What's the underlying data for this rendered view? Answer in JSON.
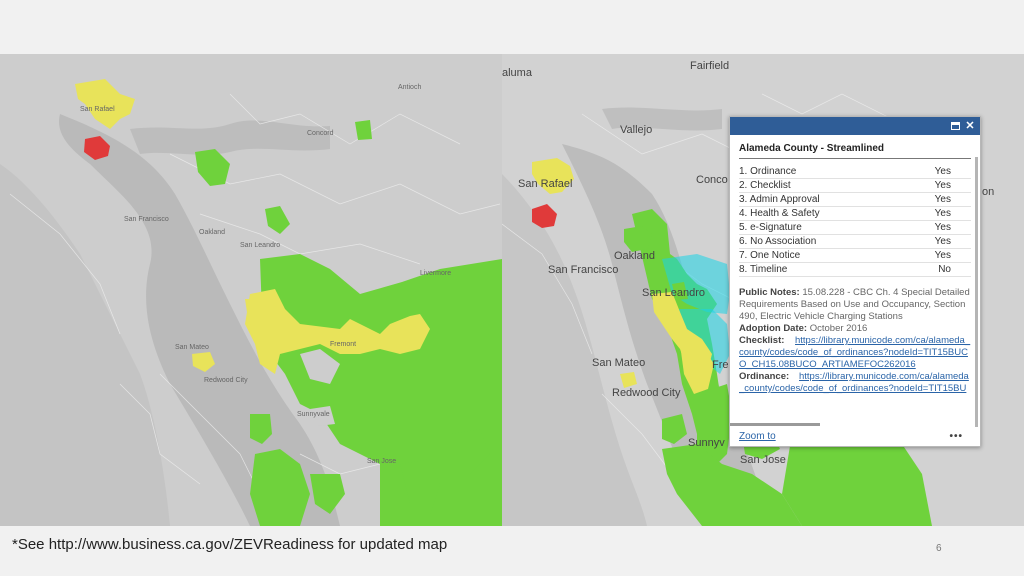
{
  "map_left": {
    "places": [
      "San Rafael",
      "Concord",
      "Antioch",
      "Oakland",
      "San Francisco",
      "San Leandro",
      "Livermore",
      "Fremont",
      "San Mateo",
      "Redwood City",
      "Sunnyvale",
      "San Jose"
    ]
  },
  "map_right": {
    "places": [
      "aluma",
      "Fairfield",
      "Vallejo",
      "Conco",
      "San Rafael",
      "Oakland",
      "San Francisco",
      "San Leandro",
      "San Mateo",
      "Redwood City",
      "Fre",
      "Sunnyv",
      "San Jose",
      "on"
    ]
  },
  "colors": {
    "streamlined": "#6fd23c",
    "partial": "#e8e35a",
    "not_streamlined": "#e03a3a",
    "highlight": "#19d3e6",
    "popup_header": "#2f5d97"
  },
  "popup": {
    "maximize_icon": "maximize-icon",
    "close_icon": "close-icon",
    "close_label": "✕",
    "title": "Alameda County - Streamlined",
    "rows": [
      {
        "label": "1. Ordinance",
        "value": "Yes"
      },
      {
        "label": "2. Checklist",
        "value": "Yes"
      },
      {
        "label": "3. Admin Approval",
        "value": "Yes"
      },
      {
        "label": "4. Health & Safety",
        "value": "Yes"
      },
      {
        "label": "5. e-Signature",
        "value": "Yes"
      },
      {
        "label": "6. No Association",
        "value": "Yes"
      },
      {
        "label": "7. One Notice",
        "value": "Yes"
      },
      {
        "label": "8. Timeline",
        "value": "No"
      }
    ],
    "public_notes_label": "Public Notes:",
    "public_notes": "15.08.228 - CBC Ch. 4 Special Detailed Requirements Based on Use and Occupancy, Section 490, Electric Vehicle Charging Stations",
    "adoption_label": "Adoption Date:",
    "adoption_date": "October 2016",
    "checklist_label": "Checklist:",
    "checklist_link": "https://library.municode.com/ca/alameda_county/codes/code_of_ordinances?nodeId=TIT15BUCO_CH15.08BUCO_ARTIAMEFOC262016",
    "ordinance_label": "Ordinance:",
    "ordinance_link": "https://library.municode.com/ca/alameda_county/codes/code_of_ordinances?nodeId=TIT15BUCO_CH15.08BUCO_ARTIAMEFOC262016",
    "zoom_label": "Zoom to",
    "more_label": "•••"
  },
  "footnote": "*See http://www.business.ca.gov/ZEVReadiness for updated map",
  "page_number": "6"
}
